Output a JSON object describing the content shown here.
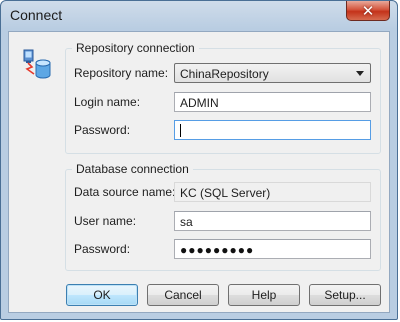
{
  "window": {
    "title": "Connect",
    "close_glyph": "✕"
  },
  "icon": {
    "name": "database-connect-icon"
  },
  "repository_group": {
    "legend": "Repository connection",
    "repository_name_label": "Repository name:",
    "repository_name_value": "ChinaRepository",
    "login_name_label": "Login name:",
    "login_name_value": "ADMIN",
    "password_label": "Password:",
    "password_value": ""
  },
  "database_group": {
    "legend": "Database connection",
    "data_source_label": "Data source name:",
    "data_source_value": "KC (SQL Server)",
    "user_name_label": "User name:",
    "user_name_value": "sa",
    "password_label": "Password:",
    "password_mask": "●●●●●●●●●"
  },
  "buttons": {
    "ok": "OK",
    "cancel": "Cancel",
    "help": "Help",
    "setup": "Setup..."
  },
  "colors": {
    "title_bar": "#b9cde2",
    "close_button": "#c4321a",
    "dialog_background": "#f0f0f0",
    "focus_border": "#569de5"
  }
}
